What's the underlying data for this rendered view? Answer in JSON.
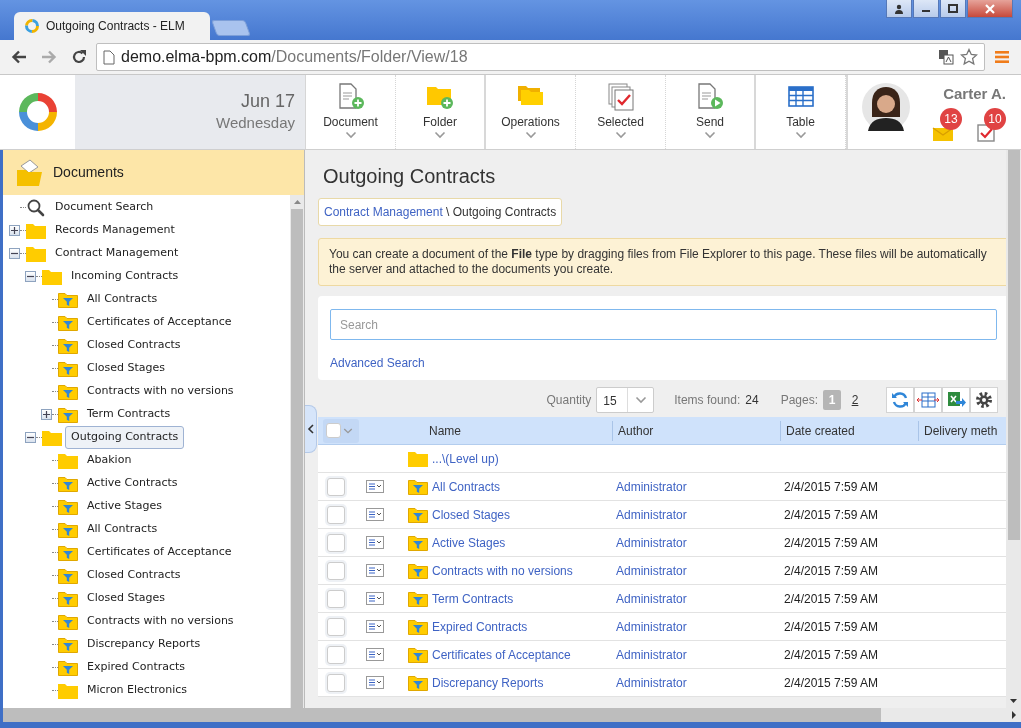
{
  "browser": {
    "tab_title": "Outgoing Contracts - ELM",
    "url_host": "demo.elma-bpm.com",
    "url_path": "/Documents/Folder/View/18"
  },
  "header": {
    "date": "Jun 17",
    "weekday": "Wednesday",
    "toolbar": [
      {
        "label": "Document",
        "kind": "document"
      },
      {
        "label": "Folder",
        "kind": "folder"
      },
      {
        "label": "Operations",
        "kind": "operations"
      },
      {
        "label": "Selected",
        "kind": "selected"
      },
      {
        "label": "Send",
        "kind": "send"
      },
      {
        "label": "Table",
        "kind": "table"
      }
    ],
    "user": {
      "name": "Carter A.",
      "notifications": [
        {
          "kind": "mail",
          "count": "13"
        },
        {
          "kind": "tasks",
          "count": "10"
        }
      ]
    }
  },
  "sidebar": {
    "title": "Documents",
    "tree": [
      {
        "label": "Document Search",
        "kind": "search",
        "selected": false
      },
      {
        "label": "Records Management",
        "kind": "folder",
        "selected": false,
        "expanded": false
      },
      {
        "label": "Contract Management",
        "kind": "folder",
        "selected": false,
        "expanded": true,
        "children": [
          {
            "label": "Incoming Contracts",
            "kind": "folder",
            "selected": false,
            "expanded": true,
            "children": [
              {
                "label": "All Contracts",
                "kind": "filter",
                "selected": false
              },
              {
                "label": "Certificates of Acceptance",
                "kind": "filter",
                "selected": false
              },
              {
                "label": "Closed Contracts",
                "kind": "filter",
                "selected": false
              },
              {
                "label": "Closed Stages",
                "kind": "filter",
                "selected": false
              },
              {
                "label": "Contracts with no versions",
                "kind": "filter",
                "selected": false
              },
              {
                "label": "Term Contracts",
                "kind": "filter",
                "selected": false,
                "expanded": false
              }
            ]
          },
          {
            "label": "Outgoing Contracts",
            "kind": "folder",
            "selected": true,
            "expanded": true,
            "children": [
              {
                "label": "Abakion",
                "kind": "folder",
                "selected": false
              },
              {
                "label": "Active Contracts",
                "kind": "filter",
                "selected": false
              },
              {
                "label": "Active Stages",
                "kind": "filter",
                "selected": false
              },
              {
                "label": "All Contracts",
                "kind": "filter",
                "selected": false
              },
              {
                "label": "Certificates of Acceptance",
                "kind": "filter",
                "selected": false
              },
              {
                "label": "Closed Contracts",
                "kind": "filter",
                "selected": false
              },
              {
                "label": "Closed Stages",
                "kind": "filter",
                "selected": false
              },
              {
                "label": "Contracts with no versions",
                "kind": "filter",
                "selected": false
              },
              {
                "label": "Discrepancy Reports",
                "kind": "filter",
                "selected": false
              },
              {
                "label": "Expired Contracts",
                "kind": "filter",
                "selected": false
              },
              {
                "label": "Micron Electronics",
                "kind": "folder",
                "selected": false
              }
            ]
          }
        ]
      }
    ]
  },
  "page": {
    "title": "Outgoing Contracts",
    "breadcrumb": {
      "parent": "Contract Management",
      "separator": "\\",
      "current": "Outgoing Contracts"
    },
    "info_lines": [
      "You can create a document of the **File** type by dragging files from File Explorer to this page. These files will be automatically",
      "the server and attached to the documents you create."
    ],
    "search": {
      "placeholder": "Search",
      "advanced_link": "Advanced Search"
    },
    "list_bar": {
      "quantity_label": "Quantity",
      "quantity": "15",
      "found_label": "Items found:",
      "found": "24",
      "pages_label": "Pages:",
      "pages": [
        {
          "label": "1",
          "selected": true
        },
        {
          "label": "2",
          "selected": false
        }
      ]
    },
    "table": {
      "select_all": {
        "checked": false
      },
      "columns": [
        "Name",
        "Author",
        "Date created",
        "Delivery meth"
      ],
      "rows": [
        {
          "kind": "up",
          "name": "...\\(Level up)"
        },
        {
          "kind": "filter",
          "name": "All Contracts",
          "author": "Administrator",
          "date": "2/4/2015 7:59 AM",
          "checked": false
        },
        {
          "kind": "filter",
          "name": "Closed Stages",
          "author": "Administrator",
          "date": "2/4/2015 7:59 AM",
          "checked": false
        },
        {
          "kind": "filter",
          "name": "Active Stages",
          "author": "Administrator",
          "date": "2/4/2015 7:59 AM",
          "checked": false
        },
        {
          "kind": "filter",
          "name": "Contracts with no versions",
          "author": "Administrator",
          "date": "2/4/2015 7:59 AM",
          "checked": false
        },
        {
          "kind": "filter",
          "name": "Term Contracts",
          "author": "Administrator",
          "date": "2/4/2015 7:59 AM",
          "checked": false
        },
        {
          "kind": "filter",
          "name": "Expired Contracts",
          "author": "Administrator",
          "date": "2/4/2015 7:59 AM",
          "checked": false
        },
        {
          "kind": "filter",
          "name": "Certificates of Acceptance",
          "author": "Administrator",
          "date": "2/4/2015 7:59 AM",
          "checked": false
        },
        {
          "kind": "filter",
          "name": "Discrepancy Reports",
          "author": "Administrator",
          "date": "2/4/2015 7:59 AM",
          "checked": false
        }
      ]
    }
  }
}
